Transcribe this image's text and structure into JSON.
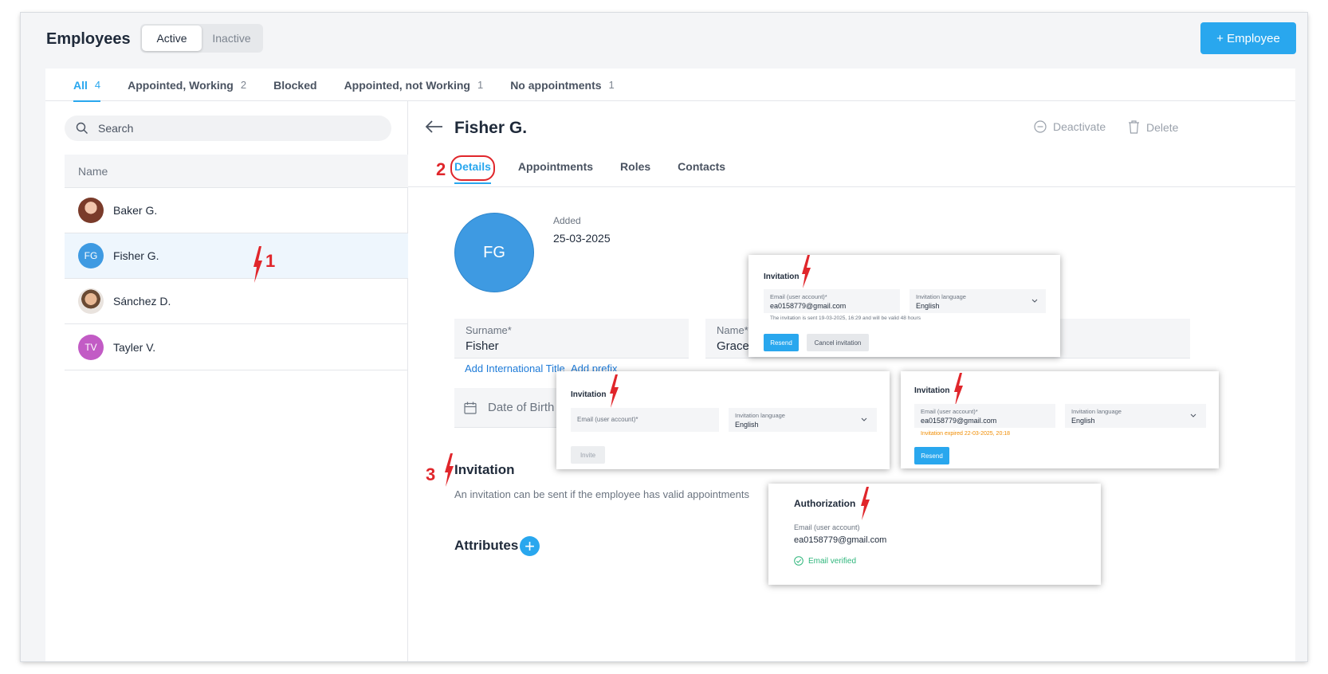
{
  "header": {
    "title": "Employees",
    "segments": [
      "Active",
      "Inactive"
    ],
    "add_button": "+ Employee"
  },
  "tabs": [
    {
      "label": "All",
      "count": "4"
    },
    {
      "label": "Appointed, Working",
      "count": "2"
    },
    {
      "label": "Blocked",
      "count": ""
    },
    {
      "label": "Appointed, not Working",
      "count": "1"
    },
    {
      "label": "No appointments",
      "count": "1"
    }
  ],
  "list": {
    "search_placeholder": "Search",
    "column": "Name",
    "rows": [
      {
        "name": "Baker G.",
        "initials": "",
        "color": "#c9876b"
      },
      {
        "name": "Fisher G.",
        "initials": "FG",
        "color": "#3e9ae2"
      },
      {
        "name": "Sánchez D.",
        "initials": "",
        "color": "#b98c6d"
      },
      {
        "name": "Tayler V.",
        "initials": "TV",
        "color": "#c25bc5"
      }
    ]
  },
  "detail": {
    "name": "Fisher G.",
    "deactivate": "Deactivate",
    "delete": "Delete",
    "tabs": [
      "Details",
      "Appointments",
      "Roles",
      "Contacts"
    ],
    "initials": "FG",
    "added_label": "Added",
    "added_value": "25-03-2025",
    "surname_label": "Surname*",
    "surname_value": "Fisher",
    "name_label": "Name*",
    "name_value": "Grace",
    "add_title_link": "Add International Title",
    "add_prefix_link": "Add prefix",
    "dob_label": "Date of Birth",
    "invitation_title": "Invitation",
    "invitation_desc": "An invitation can be sent if the employee has valid appointments",
    "attributes_title": "Attributes"
  },
  "annotations": [
    "1",
    "2",
    "3"
  ],
  "popups": {
    "sent": {
      "title": "Invitation",
      "email_label": "Email (user account)*",
      "email_value": "ea0158779@gmail.com",
      "lang_label": "Invitation language",
      "lang_value": "English",
      "note": "The invitation is sent 19-03-2025, 16:29 and will be valid 48 hours",
      "resend": "Resend",
      "cancel": "Cancel invitation"
    },
    "empty": {
      "title": "Invitation",
      "email_label": "Email (user account)*",
      "lang_label": "Invitation language",
      "lang_value": "English",
      "invite": "Invite"
    },
    "expired": {
      "title": "Invitation",
      "email_label": "Email (user account)*",
      "email_value": "ea0158779@gmail.com",
      "lang_label": "Invitation language",
      "lang_value": "English",
      "note": "Invitation expired 22-03-2025, 20:18",
      "resend": "Resend"
    },
    "auth": {
      "title": "Authorization",
      "email_label": "Email (user account)",
      "email_value": "ea0158779@gmail.com",
      "verified": "Email verified"
    }
  },
  "colors": {
    "accent": "#29a7ee",
    "annotation": "#e0262b",
    "warning": "#f08c00",
    "success": "#2fb67c"
  }
}
